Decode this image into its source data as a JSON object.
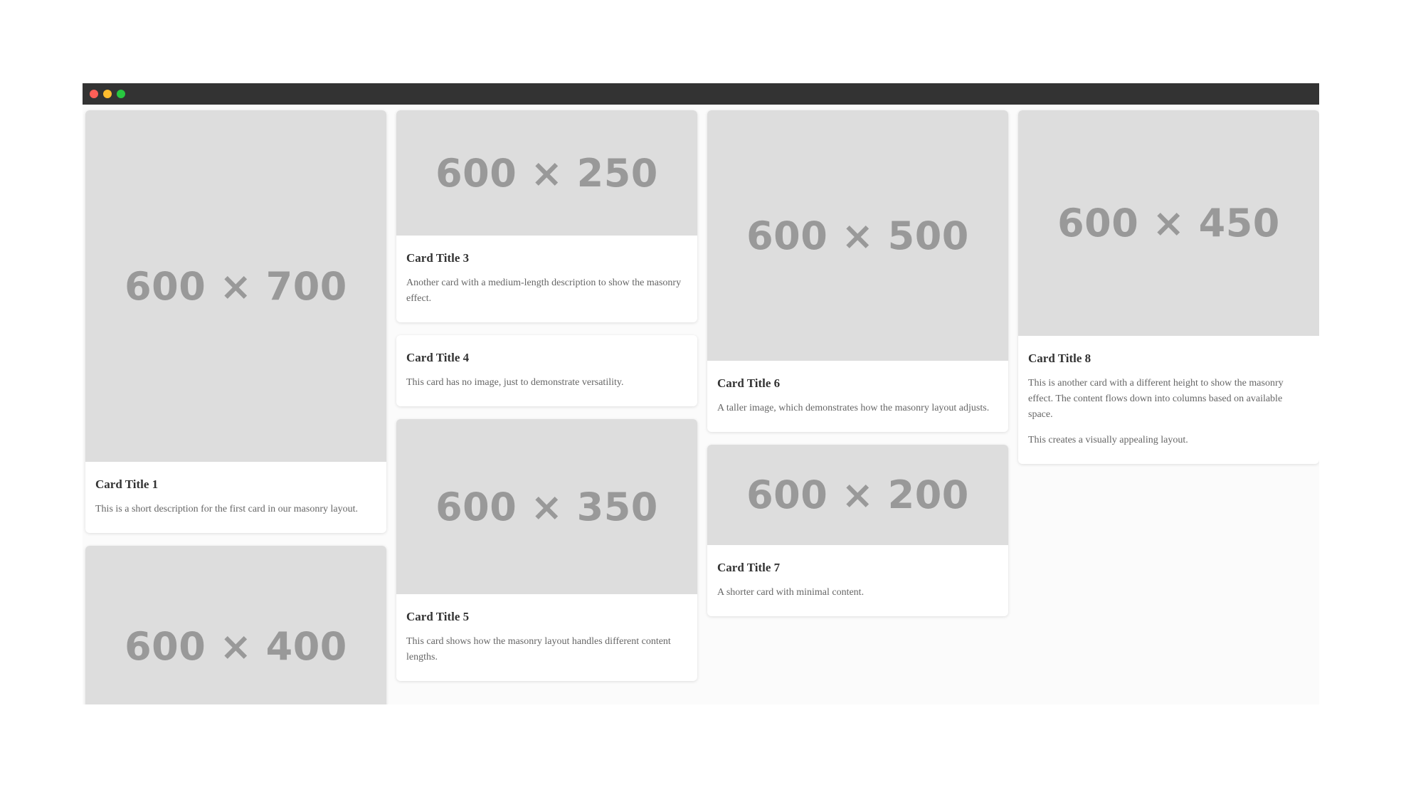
{
  "window": {
    "controls": [
      "close",
      "minimize",
      "zoom"
    ]
  },
  "cards": [
    {
      "placeholder": "600 × 700",
      "title": "Card Title 1",
      "text": [
        "This is a short description for the first card in our masonry layout."
      ]
    },
    {
      "placeholder": "600 × 400"
    },
    {
      "placeholder": "600 × 250",
      "title": "Card Title 3",
      "text": [
        "Another card with a medium-length description to show the masonry effect."
      ]
    },
    {
      "title": "Card Title 4",
      "text": [
        "This card has no image, just to demonstrate versatility."
      ]
    },
    {
      "placeholder": "600 × 350",
      "title": "Card Title 5",
      "text": [
        "This card shows how the masonry layout handles different content lengths."
      ]
    },
    {
      "placeholder": "600 × 500",
      "title": "Card Title 6",
      "text": [
        "A taller image, which demonstrates how the masonry layout adjusts."
      ]
    },
    {
      "placeholder": "600 × 200",
      "title": "Card Title 7",
      "text": [
        "A shorter card with minimal content."
      ]
    },
    {
      "placeholder": "600 × 450",
      "title": "Card Title 8",
      "text": [
        "This is another card with a different height to show the masonry effect. The content flows down into columns based on available space.",
        "This creates a visually appealing layout."
      ]
    }
  ],
  "colors": {
    "titlebar": "#333333",
    "close": "#ff5f57",
    "minimize": "#febc2e",
    "zoom": "#28c840",
    "placeholder_bg": "#dddddd",
    "placeholder_text": "#999999"
  }
}
